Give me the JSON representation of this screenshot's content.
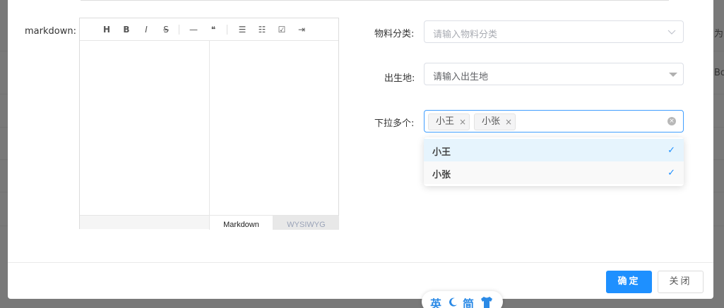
{
  "background": {
    "side_text_1": "为",
    "side_text_2": "Bo"
  },
  "form": {
    "markdown_label": "markdown:",
    "category_label": "物料分类:",
    "category_placeholder": "请输入物料分类",
    "birthplace_label": "出生地:",
    "birthplace_value": "请输入出生地",
    "multi_label": "下拉多个:"
  },
  "editor": {
    "toolbar": [
      {
        "name": "heading-icon",
        "glyph": "H"
      },
      {
        "name": "bold-icon",
        "glyph": "B"
      },
      {
        "name": "italic-icon",
        "glyph": "I"
      },
      {
        "name": "strikethrough-icon",
        "glyph": "S"
      },
      {
        "name": "horizontal-rule-icon",
        "glyph": "—"
      },
      {
        "name": "quote-icon",
        "glyph": "❝"
      },
      {
        "name": "bullet-list-icon",
        "glyph": "☰"
      },
      {
        "name": "ordered-list-icon",
        "glyph": "☷"
      },
      {
        "name": "task-list-icon",
        "glyph": "☑"
      },
      {
        "name": "indent-icon",
        "glyph": "⇥"
      }
    ],
    "tab_markdown": "Markdown",
    "tab_wysiwyg": "WYSIWYG"
  },
  "multi_select": {
    "tags": [
      "小王",
      "小张"
    ],
    "tag_close": "×",
    "clear": "×",
    "options": [
      {
        "label": "小王",
        "selected": true
      },
      {
        "label": "小张",
        "selected": true
      }
    ],
    "check": "✓"
  },
  "footer": {
    "confirm": "确定",
    "close": "关闭"
  },
  "lang_widget": {
    "english": "英",
    "simplified": "简"
  },
  "colors": {
    "primary": "#1e90ff",
    "focus_border": "#409eff",
    "option_hover": "#e6f4fd"
  }
}
